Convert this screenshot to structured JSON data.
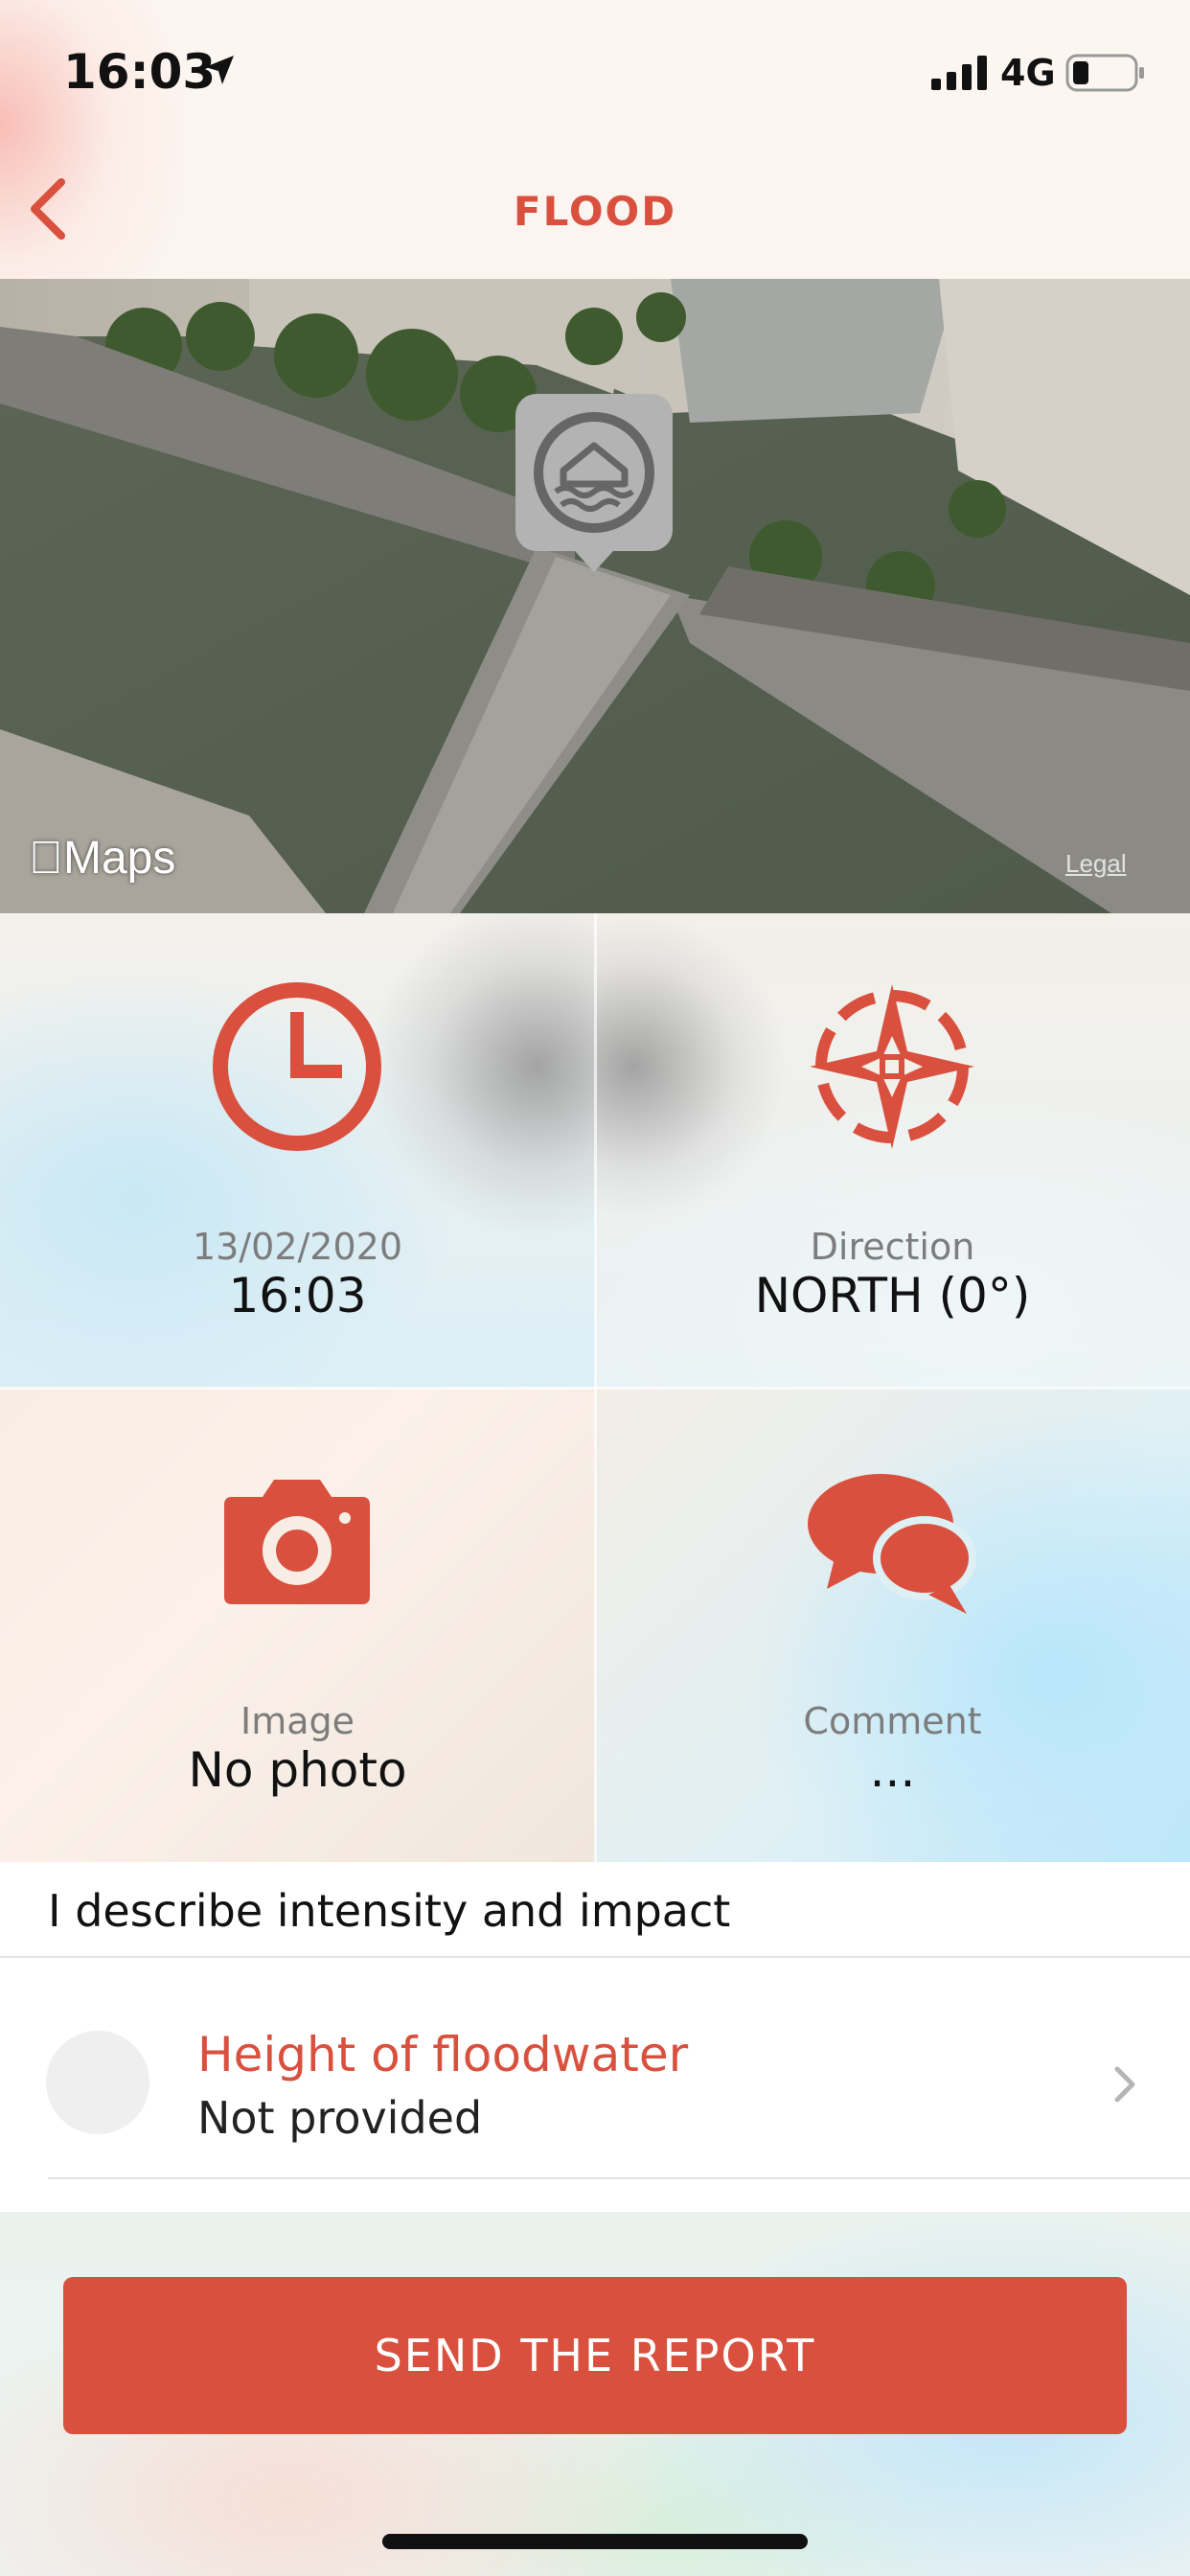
{
  "status_bar": {
    "time": "16:03",
    "network": "4G",
    "icons": [
      "location-arrow-icon",
      "signal-icon",
      "battery-icon"
    ]
  },
  "nav": {
    "back_icon": "chevron-left-icon",
    "title": "FLOOD"
  },
  "map": {
    "logo": "Maps",
    "legal": "Legal",
    "pin_icon": "flood-house-icon"
  },
  "info": {
    "date": "13/02/2020",
    "time": "16:03",
    "direction_label": "Direction",
    "direction_value": "NORTH (0°)",
    "image_label": "Image",
    "image_value": "No photo",
    "comment_label": "Comment",
    "comment_value": "..."
  },
  "section": {
    "title": "I describe intensity and impact"
  },
  "row": {
    "title": "Height of floodwater",
    "subtitle": "Not provided"
  },
  "actions": {
    "send_label": "SEND THE REPORT"
  },
  "colors": {
    "accent": "#d9503e",
    "text": "#111111",
    "muted": "#7c7c7c"
  }
}
